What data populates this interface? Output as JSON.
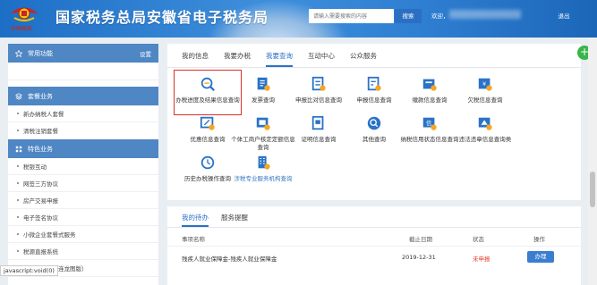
{
  "header": {
    "title": "国家税务总局安徽省电子税务局",
    "brand_sub": "中国税务",
    "search_placeholder": "请输入需要搜索的内容",
    "search_button": "搜索",
    "welcome": "欢迎，",
    "logout": "退出"
  },
  "sidebar": {
    "common": {
      "label": "常用功能",
      "settings": "设置"
    },
    "package": {
      "label": "套餐业务"
    },
    "package_items": [
      "新办纳税人套餐",
      "清税注销套餐"
    ],
    "special": {
      "label": "特色业务"
    },
    "special_items": [
      "税银互动",
      "网签三方协议",
      "房产交易申报",
      "电子签名协议",
      "小微企业套餐式服务",
      "税源直报系统",
      "出口退税（大连龙图版）"
    ]
  },
  "tabs": [
    "我的信息",
    "我要办税",
    "我要查询",
    "互动中心",
    "公众服务"
  ],
  "active_tab": "我要查询",
  "tiles": [
    {
      "label": "办税进度及结果信息查询",
      "icon": "magnifier-icon"
    },
    {
      "label": "发票查询",
      "icon": "invoice-icon"
    },
    {
      "label": "申报比对信息查询",
      "icon": "compare-icon"
    },
    {
      "label": "申报信息查询",
      "icon": "declare-icon"
    },
    {
      "label": "缴款信息查询",
      "icon": "payment-icon"
    },
    {
      "label": "欠税信息查询",
      "icon": "arrears-icon"
    },
    {
      "label": "优惠信息查询",
      "icon": "discount-icon"
    },
    {
      "label": "个体工商户核定定额信息查询",
      "icon": "household-icon"
    },
    {
      "label": "证明信息查询",
      "icon": "certificate-icon"
    },
    {
      "label": "其他查询",
      "icon": "other-search-icon"
    },
    {
      "label": "纳税信用状态信息查询",
      "icon": "credit-icon"
    },
    {
      "label": "违法违章信息查询类",
      "icon": "violation-icon"
    },
    {
      "label": "历史办税操作查询",
      "icon": "history-icon"
    },
    {
      "label": "涉税专业服务机构查询",
      "icon": "agency-icon"
    }
  ],
  "todo": {
    "tabs": [
      "我的待办",
      "服务提醒"
    ],
    "columns": [
      "事项名称",
      "截止日期",
      "状态",
      "操作"
    ],
    "rows": [
      {
        "name": "残疾人就业保障金-残疾人就业保障金",
        "deadline": "2019-12-31",
        "status": "未申报",
        "action": "办理"
      }
    ]
  },
  "statusbar": "javascript:void(0)",
  "colors": {
    "accent": "#2a72c8",
    "header": "#2f7fd2",
    "highlight": "#d9312a",
    "status_red": "#e43c2f"
  }
}
